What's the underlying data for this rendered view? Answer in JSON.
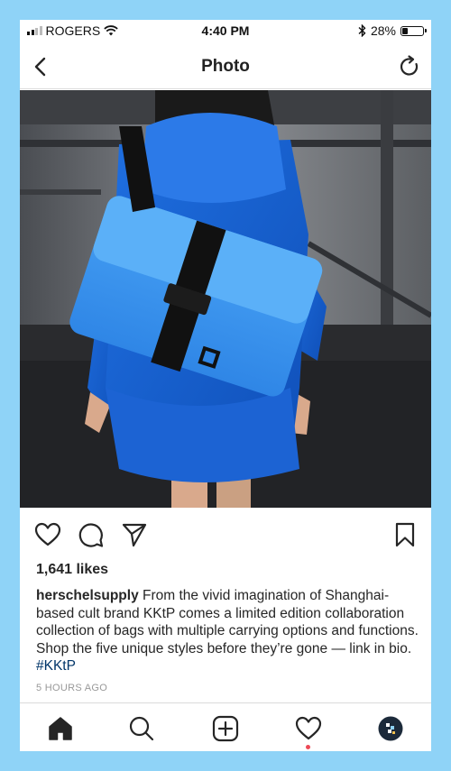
{
  "status_bar": {
    "carrier": "ROGERS",
    "time": "4:40 PM",
    "battery_percent": "28%",
    "battery_level": 0.28,
    "icons": [
      "signal-bars-icon",
      "wifi-icon",
      "bluetooth-icon",
      "battery-icon"
    ]
  },
  "navbar": {
    "title": "Photo",
    "back_icon": "chevron-left-icon",
    "refresh_icon": "refresh-icon"
  },
  "post": {
    "image_subject": "woman in blue hoodie wearing blue messenger bag",
    "actions": [
      "heart-icon",
      "comment-icon",
      "share-icon",
      "bookmark-icon"
    ],
    "likes": "1,641 likes",
    "caption": {
      "username": "herschelsupply",
      "text": " From the vivid imagination of Shanghai-based cult brand KKtP comes a limited edition collaboration collection of bags with multiple carrying options and functions. Shop the five unique styles before they’re gone — link in bio. ",
      "hashtag": "#KKtP"
    },
    "time_ago": "5 HOURS AGO"
  },
  "tab_bar": {
    "tabs": [
      "home-icon",
      "search-icon",
      "add-post-icon",
      "activity-heart-icon",
      "profile-avatar"
    ],
    "active": "home-icon",
    "activity_notification": true
  },
  "colors": {
    "background_frame": "#8fd3f7",
    "hashtag": "#003569",
    "notification_dot": "#ed4956",
    "bag_blue": "#2f8be8"
  }
}
